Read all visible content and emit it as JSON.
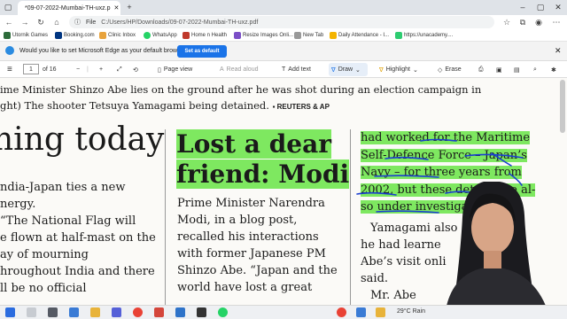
{
  "browser": {
    "tab_title": "*09-07-2022-Mumbai-TH-uxz.p",
    "url_label": "File",
    "url": "C:/Users/HP/Downloads/09-07-2022-Mumbai-TH-uxz.pdf",
    "bookmarks": [
      "Utornik Games",
      "Booking.com",
      "Clinic Inbox",
      "WhatsApp",
      "Home n Health",
      "Resize Images Onli...",
      "New Tab",
      "Daily Attendance - I...",
      "https://unacademy...."
    ],
    "banner_text": "Would you like to set Microsoft Edge as your default browser?",
    "banner_button": "Set as default"
  },
  "pdf_toolbar": {
    "page_current": "1",
    "page_total": "of 16",
    "page_view": "Page view",
    "read_aloud": "Read aloud",
    "add_text": "Add text",
    "draw": "Draw",
    "highlight": "Highlight",
    "erase": "Erase"
  },
  "article": {
    "caption_line1": "ime Minister Shinzo Abe lies on the ground after he was shot during an election campaign in",
    "caption_line2": "ght) The shooter Tetsuya Yamagami being detained.",
    "credit": "▪ REUTERS & AP",
    "headline_left": "ning today",
    "left_col": [
      "ndia-Japan ties a new",
      "nergy.",
      "  “The National Flag will",
      "e flown at half-mast on the",
      "ay of mourning",
      "hroughout India and there",
      "ll be no official"
    ],
    "headline_mid_line1": "Lost a dear",
    "headline_mid_line2": "friend: Modi",
    "mid_col": [
      "Prime Minister Narendra",
      "Modi, in a blog post,",
      "recalled his interactions",
      "with former Japanese PM",
      "Shinzo Abe. “Japan and the",
      "world have lost a great"
    ],
    "right_col_hl": [
      "had worked for the Maritime",
      "Self-Defence Force – Japan’s",
      "Navy – for three years from",
      "2002, but these details are al-",
      "so under investigation."
    ],
    "right_col": [
      "Yamagami also",
      "he had learne",
      "Abe’s visit onli",
      "said.",
      "Mr. Abe"
    ]
  },
  "system": {
    "weather": "29°C  Rain"
  }
}
